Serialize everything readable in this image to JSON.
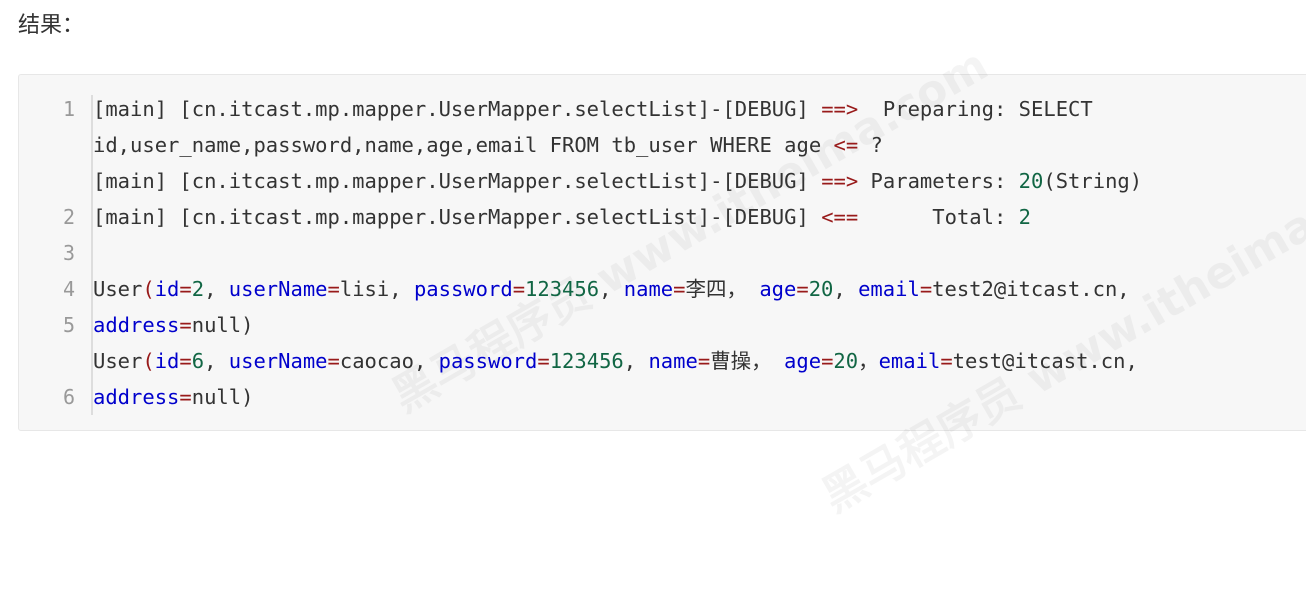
{
  "heading": "结果：",
  "colors": {
    "operator": "#981a1a",
    "number": "#116644",
    "attribute": "#0000cc",
    "text": "#333333",
    "line_number": "#999999",
    "code_bg": "#f7f7f7"
  },
  "code": {
    "line_numbers": [
      "1",
      "2",
      "3",
      "4",
      "5",
      "6"
    ],
    "l1a": {
      "p1": "[main] [cn.itcast.mp.mapper.UserMapper.selectList]-[DEBUG] ",
      "op": "==>",
      "p2": "  Preparing: SELECT"
    },
    "l1b": {
      "p1": "id,user_name,password,name,age,email FROM tb_user WHERE age ",
      "op": "<=",
      "p2": " ?"
    },
    "l2": {
      "p1": "[main] [cn.itcast.mp.mapper.UserMapper.selectList]-[DEBUG] ",
      "op": "==>",
      "p2": " Parameters: ",
      "num": "20",
      "p3": "(String)"
    },
    "l3": {
      "p1": "[main] [cn.itcast.mp.mapper.UserMapper.selectList]-[DEBUG] ",
      "op": "<==",
      "p2": "      Total: ",
      "num": "2"
    },
    "l5a": {
      "user": "User",
      "paren": "(",
      "id_key": "id",
      "id_val": "2",
      "sep1": ", ",
      "un_key": "userName",
      "un_val": "lisi",
      "sep2": ", ",
      "pw_key": "password",
      "pw_val": "123456",
      "sep3": ", ",
      "nm_key": "name",
      "nm_val": "李四，",
      "sep4": " ",
      "age_key": "age",
      "age_val": "20",
      "sep5": ", ",
      "em_key": "email",
      "em_val": "test2@itcast.cn,"
    },
    "l5b": {
      "ad_key": "address",
      "ad_val": "null)"
    },
    "l6a": {
      "user": "User",
      "paren": "(",
      "id_key": "id",
      "id_val": "6",
      "sep1": ", ",
      "un_key": "userName",
      "un_val": "caocao",
      "sep2": ", ",
      "pw_key": "password",
      "pw_val": "123456",
      "sep3": ", ",
      "nm_key": "name",
      "nm_val": "曹操，",
      "sep4": " ",
      "age_key": "age",
      "age_val": "20",
      "sep5": "，",
      "em_key": "email",
      "em_val": "test@itcast.cn,"
    },
    "l6b": {
      "ad_key": "address",
      "ad_val": "null)"
    }
  }
}
